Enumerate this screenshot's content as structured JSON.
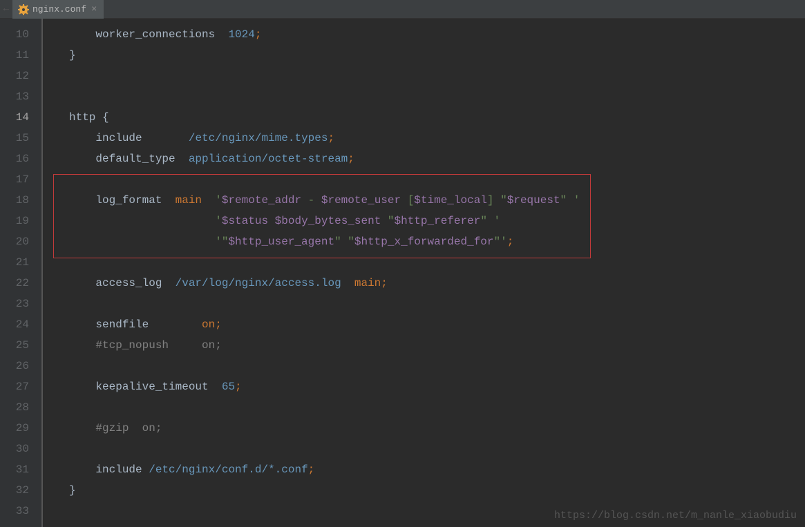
{
  "tab": {
    "filename": "nginx.conf",
    "close_glyph": "×"
  },
  "back_arrow": "←",
  "line_numbers": [
    "10",
    "11",
    "12",
    "13",
    "14",
    "15",
    "16",
    "17",
    "18",
    "19",
    "20",
    "21",
    "22",
    "23",
    "24",
    "25",
    "26",
    "27",
    "28",
    "29",
    "30",
    "31",
    "32",
    "33"
  ],
  "active_line": "14",
  "watermark": "https://blog.csdn.net/m_nanle_xiaobudiu",
  "code": {
    "l10_indent": "    ",
    "l10_a": "worker_connections",
    "l10_b": "  ",
    "l10_c": "1024",
    "l10_d": ";",
    "l11_a": "}",
    "l14_a": "http ",
    "l14_b": "{",
    "l15_indent": "    ",
    "l15_a": "include",
    "l15_b": "       ",
    "l15_c": "/etc/nginx/mime.types",
    "l15_d": ";",
    "l16_indent": "    ",
    "l16_a": "default_type",
    "l16_b": "  ",
    "l16_c": "application/octet-stream",
    "l16_d": ";",
    "l18_indent": "    ",
    "l18_a": "log_format",
    "l18_b": "  ",
    "l18_c": "main",
    "l18_d": "  ",
    "l18_e": "'",
    "l18_f": "$remote_addr",
    "l18_g": " - ",
    "l18_h": "$remote_user",
    "l18_i": " [",
    "l18_j": "$time_local",
    "l18_k": "] \"",
    "l18_l": "$request",
    "l18_m": "\" '",
    "l19_indent": "                      ",
    "l19_a": "'",
    "l19_b": "$status",
    "l19_c": " ",
    "l19_d": "$body_bytes_sent",
    "l19_e": " \"",
    "l19_f": "$http_referer",
    "l19_g": "\" '",
    "l20_indent": "                      ",
    "l20_a": "'\"",
    "l20_b": "$http_user_agent",
    "l20_c": "\" \"",
    "l20_d": "$http_x_forwarded_for",
    "l20_e": "\"'",
    "l20_f": ";",
    "l22_indent": "    ",
    "l22_a": "access_log",
    "l22_b": "  ",
    "l22_c": "/var/log/nginx/access.log",
    "l22_d": "  ",
    "l22_e": "main",
    "l22_f": ";",
    "l24_indent": "    ",
    "l24_a": "sendfile",
    "l24_b": "        ",
    "l24_c": "on",
    "l24_d": ";",
    "l25_indent": "    ",
    "l25_a": "#tcp_nopush     on;",
    "l27_indent": "    ",
    "l27_a": "keepalive_timeout",
    "l27_b": "  ",
    "l27_c": "65",
    "l27_d": ";",
    "l29_indent": "    ",
    "l29_a": "#gzip  on;",
    "l31_indent": "    ",
    "l31_a": "include",
    "l31_b": " ",
    "l31_c": "/etc/nginx/conf.d/*.conf",
    "l31_d": ";",
    "l32_a": "}"
  }
}
